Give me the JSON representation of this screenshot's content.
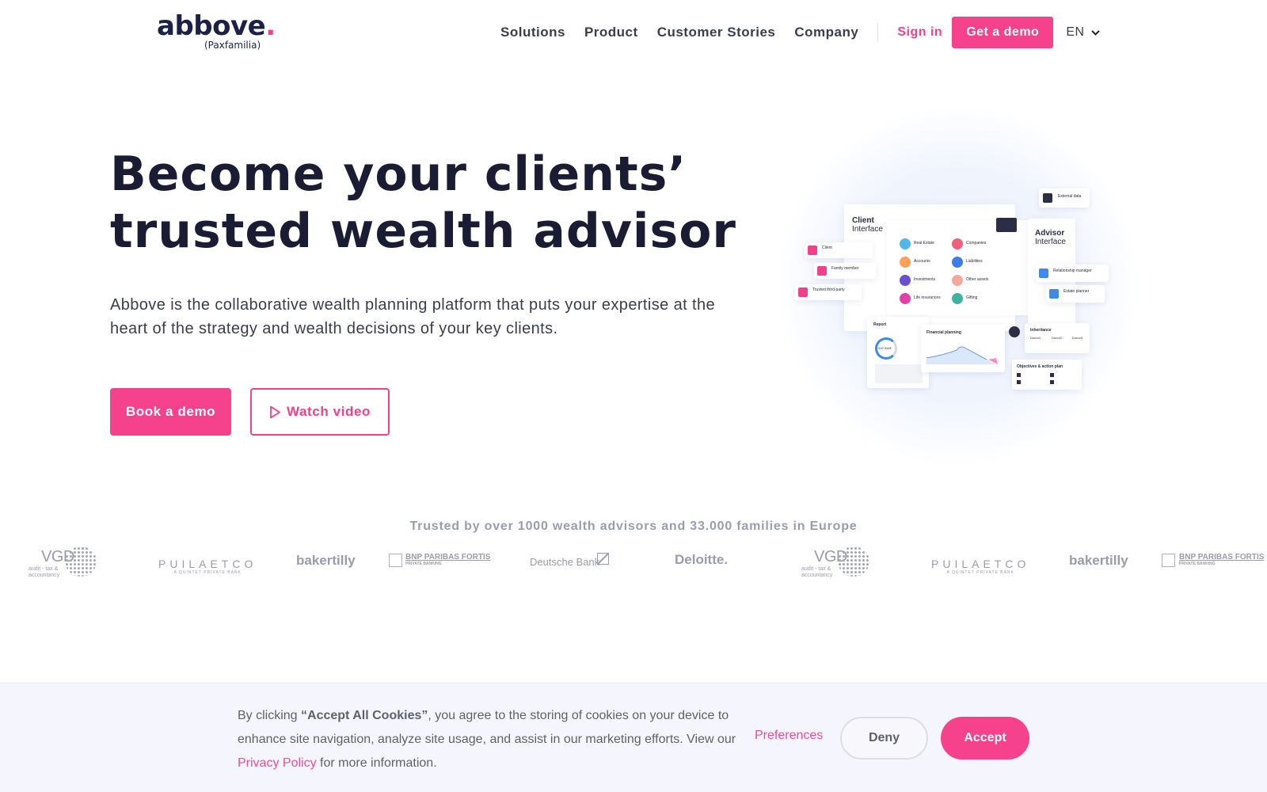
{
  "brand": {
    "name": "abbove",
    "dot": ".",
    "sub": "(Paxfamilia)",
    "accent_color": "#f6418c",
    "dark_color": "#1c2147"
  },
  "nav": {
    "items": [
      {
        "label": "Solutions"
      },
      {
        "label": "Product"
      },
      {
        "label": "Customer Stories"
      },
      {
        "label": "Company"
      }
    ],
    "signin": "Sign in",
    "demo": "Get a demo",
    "lang": "EN"
  },
  "hero": {
    "title_line1": "Become your clients’",
    "title_line2": "trusted wealth advisor",
    "description": "Abbove is the collaborative wealth planning platform that puts your expertise at the heart of the strategy and wealth decisions of your key clients.",
    "primary_btn": "Book a demo",
    "secondary_btn": "Watch video"
  },
  "illustration": {
    "client_interface": {
      "title": "Client",
      "subtitle": "Interface"
    },
    "advisor_interface": {
      "title": "Advisor",
      "subtitle": "Interface"
    },
    "client_roles": [
      "Client",
      "Family member",
      "Trusted third-party"
    ],
    "advisor_roles": [
      "Relationship manager",
      "Estate planner"
    ],
    "external": "External data",
    "assets_left": [
      {
        "label": "Real Estate",
        "color": "#52b6e6"
      },
      {
        "label": "Accounts",
        "color": "#f7a15a"
      },
      {
        "label": "Investments",
        "color": "#6a4fcf"
      },
      {
        "label": "Life insurances",
        "color": "#e040a8"
      }
    ],
    "assets_right": [
      {
        "label": "Companies",
        "color": "#f0607a"
      },
      {
        "label": "Liabilities",
        "color": "#3f7de6"
      },
      {
        "label": "Other assets",
        "color": "#f5a99b"
      },
      {
        "label": "Gifting",
        "color": "#3eb3a0"
      }
    ],
    "report": {
      "title": "Report",
      "value": "932 934€"
    },
    "financial_planning": "Financial planning",
    "inheritance": {
      "title": "Inheritance",
      "cols": [
        "Donor1",
        "Donor2",
        "Donor3"
      ]
    },
    "objectives": "Objectives & action plan"
  },
  "trusted": {
    "text": "Trusted by over 1000 wealth advisors and 33.000 families in Europe",
    "logos": [
      {
        "name": "VGD",
        "sub": "audit - tax & accountancy"
      },
      {
        "name": "PUILAETCO",
        "sub": "A QUINTET PRIVATE BANK"
      },
      {
        "name": "bakertilly"
      },
      {
        "name": "BNP PARIBAS FORTIS",
        "sub": "PRIVATE BANKING"
      },
      {
        "name": "Deutsche Bank"
      },
      {
        "name": "Deloitte."
      }
    ]
  },
  "cookie": {
    "prefix": "By clicking ",
    "bold": "“Accept All Cookies”",
    "middle": ", you agree to the storing of cookies on your device to enhance site navigation, analyze site usage, and assist in our marketing efforts. View our ",
    "link": "Privacy Policy",
    "suffix": " for more information.",
    "preferences": "Preferences",
    "deny": "Deny",
    "accept": "Accept"
  }
}
